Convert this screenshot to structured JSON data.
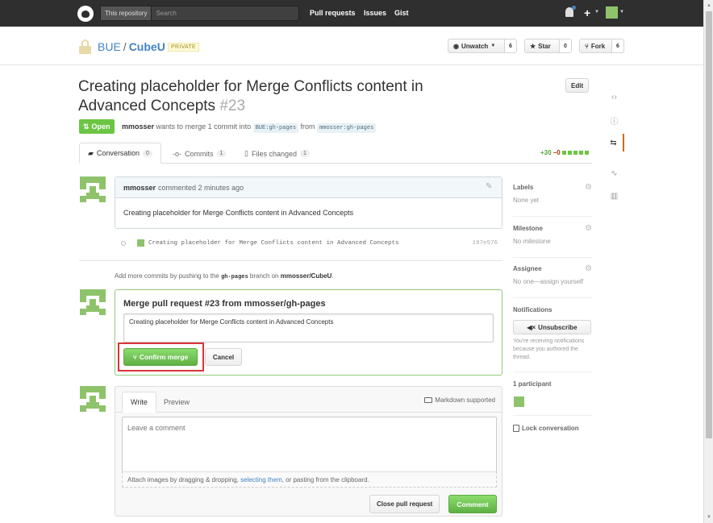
{
  "header": {
    "search_scope": "This repository",
    "search_placeholder": "Search",
    "nav": [
      "Pull requests",
      "Issues",
      "Gist"
    ],
    "plus_label": "+"
  },
  "repo": {
    "owner": "BUE",
    "name": "CubeU",
    "visibility": "PRIVATE",
    "unwatch_label": "Unwatch",
    "unwatch_count": "6",
    "star_label": "Star",
    "star_count": "0",
    "fork_label": "Fork",
    "fork_count": "6"
  },
  "pr": {
    "title": "Creating placeholder for Merge Conflicts content in Advanced Concepts",
    "number": "#23",
    "edit_label": "Edit",
    "state": "Open",
    "author": "mmosser",
    "meta_text": "wants to merge 1 commit into",
    "base_branch": "BUE:gh-pages",
    "from_text": "from",
    "head_branch": "mmosser:gh-pages"
  },
  "tabs": [
    {
      "label": "Conversation",
      "count": "0"
    },
    {
      "label": "Commits",
      "count": "1"
    },
    {
      "label": "Files changed",
      "count": "1"
    }
  ],
  "diffstat": {
    "additions": "+30",
    "deletions": "−0"
  },
  "comment": {
    "author": "mmosser",
    "action": "commented 2 minutes ago",
    "body": "Creating placeholder for Merge Conflicts content in Advanced Concepts"
  },
  "commit": {
    "message": "Creating placeholder for Merge Conflicts content in Advanced Concepts",
    "sha": "197e576"
  },
  "hint": {
    "prefix": "Add more commits by pushing to the",
    "branch": "gh-pages",
    "middle": "branch on",
    "repo": "mmosser/CubeU",
    "suffix": "."
  },
  "merge": {
    "title": "Merge pull request #23 from mmosser/gh-pages",
    "message": "Creating placeholder for Merge Conflicts content in Advanced Concepts",
    "confirm_label": "Confirm merge",
    "cancel_label": "Cancel"
  },
  "form": {
    "write_tab": "Write",
    "preview_tab": "Preview",
    "markdown_label": "Markdown supported",
    "placeholder": "Leave a comment",
    "attach_prefix": "Attach images by dragging & dropping,",
    "attach_link": "selecting them",
    "attach_suffix": ", or pasting from the clipboard.",
    "close_label": "Close pull request",
    "comment_label": "Comment"
  },
  "sidebar": {
    "labels_title": "Labels",
    "labels_value": "None yet",
    "milestone_title": "Milestone",
    "milestone_value": "No milestone",
    "assignee_title": "Assignee",
    "assignee_value": "No one—assign yourself",
    "notifications_title": "Notifications",
    "unsubscribe_label": "Unsubscribe",
    "notifications_text": "You're receiving notifications because you authored the thread.",
    "participants_title": "1 participant",
    "lock_label": "Lock conversation"
  },
  "colors": {
    "open_green": "#6cc644",
    "link_blue": "#4183c4",
    "highlight_red": "#d9343a",
    "identicon_green": "#8fc36b"
  }
}
